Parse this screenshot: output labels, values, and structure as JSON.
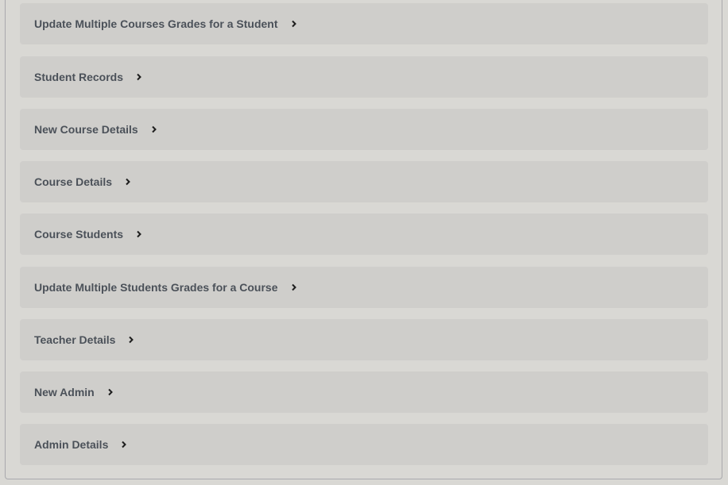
{
  "items": [
    {
      "label": "Update Multiple Courses Grades for a Student"
    },
    {
      "label": "Student Records"
    },
    {
      "label": "New Course Details"
    },
    {
      "label": "Course Details"
    },
    {
      "label": "Course Students"
    },
    {
      "label": "Update Multiple Students Grades for a Course"
    },
    {
      "label": "Teacher Details"
    },
    {
      "label": "New Admin"
    },
    {
      "label": "Admin Details"
    }
  ]
}
